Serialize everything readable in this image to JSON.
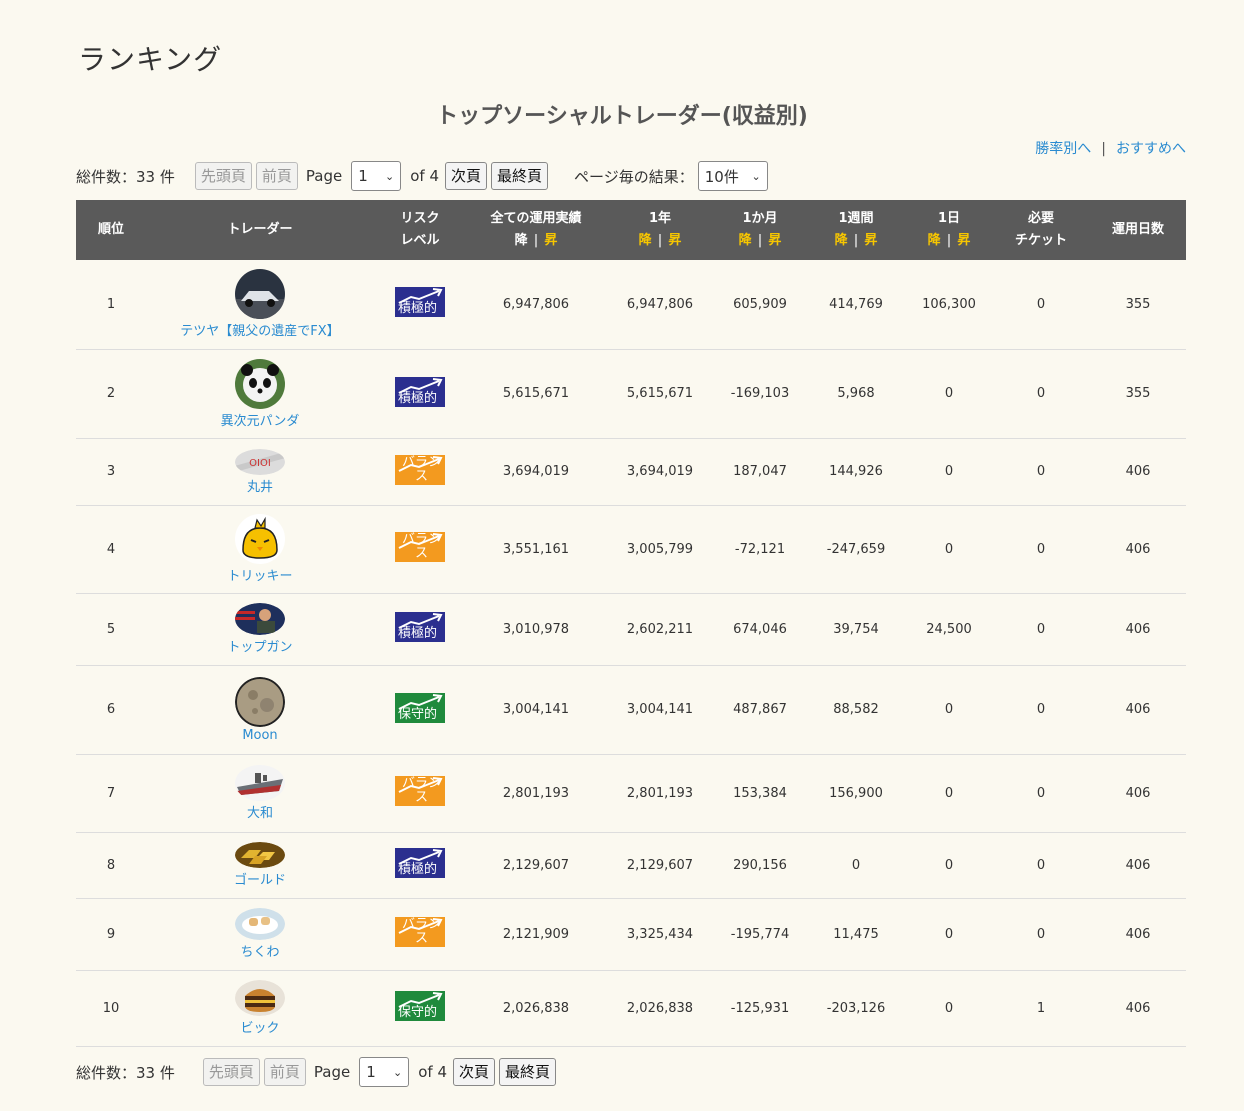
{
  "page": {
    "heading": "ランキング",
    "title": "トップソーシャルトレーダー(収益別)"
  },
  "links": {
    "win_rate": "勝率別へ",
    "separator": "|",
    "recommended": "おすすめへ"
  },
  "pager": {
    "total": "総件数：33 件",
    "first": "先頭頁",
    "prev": "前頁",
    "page_label": "Page",
    "page_value": "1",
    "of_label": "of 4",
    "next": "次頁",
    "last": "最終頁",
    "per_page_label": "ページ毎の結果：",
    "per_page_value": "10件"
  },
  "table": {
    "headers": {
      "rank": "順位",
      "trader": "トレーダー",
      "risk_1": "リスク",
      "risk_2": "レベル",
      "all": "全ての運用実績",
      "y1": "1年",
      "m1": "1か月",
      "w1": "1週間",
      "d1": "1日",
      "ticket_1": "必要",
      "ticket_2": "チケット",
      "days": "運用日数",
      "desc": "降",
      "asc": "昇",
      "bar": "|"
    },
    "rows": [
      {
        "rank": "1",
        "name": "テツヤ【親父の遺産でFX】",
        "avatar": "car-avatar",
        "risk": "積極的",
        "risk_color": "#2b2f8f",
        "all": "6,947,806",
        "y1": "6,947,806",
        "m1": "605,909",
        "w1": "414,769",
        "d1": "106,300",
        "ticket": "0",
        "days": "355"
      },
      {
        "rank": "2",
        "name": "異次元パンダ",
        "avatar": "panda-avatar",
        "risk": "積極的",
        "risk_color": "#2b2f8f",
        "all": "5,615,671",
        "y1": "5,615,671",
        "m1": "-169,103",
        "w1": "5,968",
        "d1": "0",
        "ticket": "0",
        "days": "355"
      },
      {
        "rank": "3",
        "name": "丸井",
        "avatar": "marui-logo-avatar",
        "risk": "バランス",
        "risk_color": "#f39a1f",
        "all": "3,694,019",
        "y1": "3,694,019",
        "m1": "187,047",
        "w1": "144,926",
        "d1": "0",
        "ticket": "0",
        "days": "406"
      },
      {
        "rank": "4",
        "name": "トリッキー",
        "avatar": "chick-avatar",
        "risk": "バランス",
        "risk_color": "#f39a1f",
        "all": "3,551,161",
        "y1": "3,005,799",
        "m1": "-72,121",
        "w1": "-247,659",
        "d1": "0",
        "ticket": "0",
        "days": "406"
      },
      {
        "rank": "5",
        "name": "トップガン",
        "avatar": "pilot-avatar",
        "risk": "積極的",
        "risk_color": "#2b2f8f",
        "all": "3,010,978",
        "y1": "2,602,211",
        "m1": "674,046",
        "w1": "39,754",
        "d1": "24,500",
        "ticket": "0",
        "days": "406"
      },
      {
        "rank": "6",
        "name": "Moon",
        "avatar": "moon-avatar",
        "risk": "保守的",
        "risk_color": "#1f8a3c",
        "all": "3,004,141",
        "y1": "3,004,141",
        "m1": "487,867",
        "w1": "88,582",
        "d1": "0",
        "ticket": "0",
        "days": "406"
      },
      {
        "rank": "7",
        "name": "大和",
        "avatar": "battleship-avatar",
        "risk": "バランス",
        "risk_color": "#f39a1f",
        "all": "2,801,193",
        "y1": "2,801,193",
        "m1": "153,384",
        "w1": "156,900",
        "d1": "0",
        "ticket": "0",
        "days": "406"
      },
      {
        "rank": "8",
        "name": "ゴールド",
        "avatar": "gold-bars-avatar",
        "risk": "積極的",
        "risk_color": "#2b2f8f",
        "all": "2,129,607",
        "y1": "2,129,607",
        "m1": "290,156",
        "w1": "0",
        "d1": "0",
        "ticket": "0",
        "days": "406"
      },
      {
        "rank": "9",
        "name": "ちくわ",
        "avatar": "chikuwa-avatar",
        "risk": "バランス",
        "risk_color": "#f39a1f",
        "all": "2,121,909",
        "y1": "3,325,434",
        "m1": "-195,774",
        "w1": "11,475",
        "d1": "0",
        "ticket": "0",
        "days": "406"
      },
      {
        "rank": "10",
        "name": "ビック",
        "avatar": "burger-avatar",
        "risk": "保守的",
        "risk_color": "#1f8a3c",
        "all": "2,026,838",
        "y1": "2,026,838",
        "m1": "-125,931",
        "w1": "-203,126",
        "d1": "0",
        "ticket": "1",
        "days": "406"
      }
    ]
  },
  "colors": {
    "background": "#fbf9f0",
    "header_bg": "#5a5a5a",
    "link": "#2a8bd0",
    "sort_asc": "#f7c600"
  }
}
